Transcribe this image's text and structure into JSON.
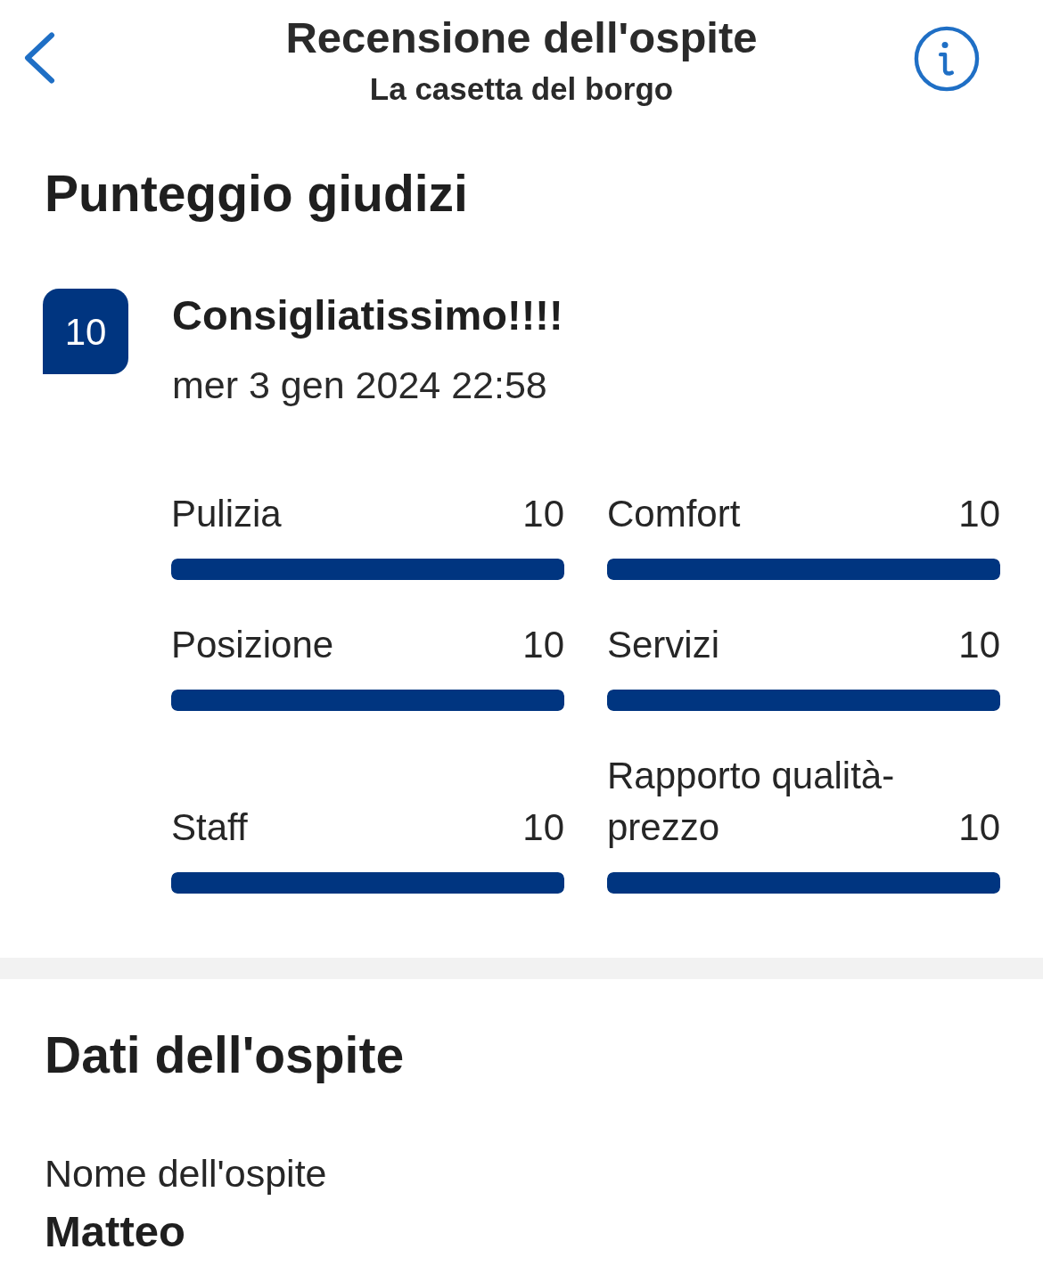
{
  "header": {
    "title": "Recensione dell'ospite",
    "subtitle": "La casetta del borgo"
  },
  "scores_section": {
    "heading": "Punteggio giudizi",
    "review": {
      "score": "10",
      "title": "Consigliatissimo!!!!",
      "date": "mer 3 gen 2024 22:58"
    },
    "categories": [
      {
        "label": "Pulizia",
        "score": "10",
        "level": 1
      },
      {
        "label": "Posizione",
        "score": "10",
        "level": 1
      },
      {
        "label": "Staff",
        "score": "10",
        "level": 1
      },
      {
        "label": "Comfort",
        "score": "10",
        "level": 1
      },
      {
        "label": "Servizi",
        "score": "10",
        "level": 1
      },
      {
        "label": "Rapporto qualità-prezzo",
        "score": "10",
        "level": 1
      }
    ]
  },
  "guest_section": {
    "heading": "Dati dell'ospite",
    "fields": [
      {
        "label": "Nome dell'ospite",
        "value": "Matteo"
      }
    ]
  }
}
